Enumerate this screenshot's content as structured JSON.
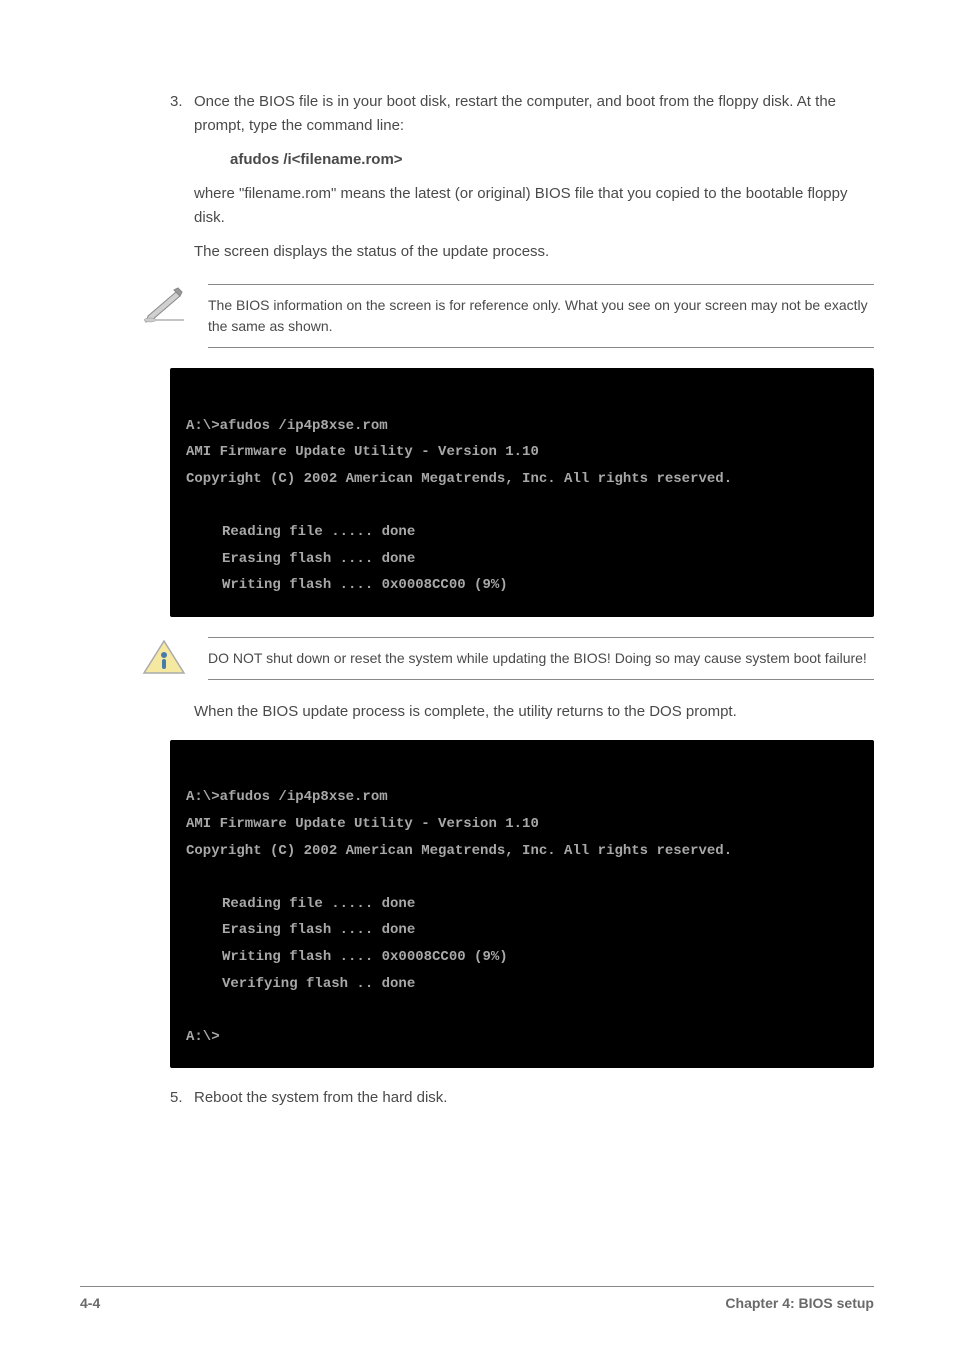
{
  "intro": "The BIOS information on the screen is for reference only. What you see on your screen may not be exactly the same as shown.",
  "step3_a": "3.",
  "step3_b": "Once the BIOS file is in your boot disk, restart the computer, and boot from the floppy disk. At the prompt, type the command line:",
  "cmd_syntax": "afudos /i<filename.rom>",
  "cmd_note": "where \"filename.rom\" means the latest (or original) BIOS file that you copied to the bootable floppy disk.",
  "cmd_action": "The screen displays the status of the update process.",
  "note_bios": "The BIOS information on the screen is for reference only. What you see on your screen may not be exactly the same as shown.",
  "terminal1": {
    "line1": "A:\\>afudos /ip4p8xse.rom",
    "line2": "AMI Firmware Update Utility - Version 1.10",
    "line3": "Copyright (C) 2002 American Megatrends, Inc. All rights reserved.",
    "line4": "Reading file ..... done",
    "line5": "Erasing flash .... done",
    "line6": "Writing flash .... 0x0008CC00 (9%)"
  },
  "warning": "DO NOT shut down or reset the system while updating the BIOS! Doing so may cause system boot failure!",
  "post_terminal": "When the BIOS update process is complete, the utility returns to the DOS prompt.",
  "terminal2": {
    "line1": "A:\\>afudos /ip4p8xse.rom",
    "line2": "AMI Firmware Update Utility - Version 1.10",
    "line3": "Copyright (C) 2002 American Megatrends, Inc. All rights reserved.",
    "line4": "Reading file ..... done",
    "line5": "Erasing flash .... done",
    "line6": "Writing flash .... 0x0008CC00 (9%)",
    "line7": "Verifying flash .. done",
    "line8": "A:\\>"
  },
  "step5_a": "5.",
  "step5_b": "Reboot the system from the hard disk.",
  "footer_page": "4-4",
  "footer_title": "Chapter 4: BIOS setup"
}
